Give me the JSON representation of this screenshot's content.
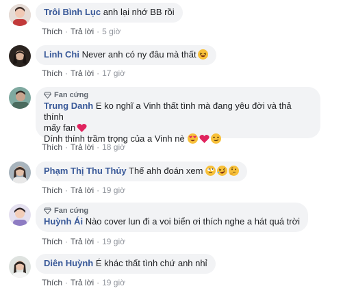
{
  "comments": [
    {
      "author": "Trôi Bình Lục",
      "text": "anh lại nhớ BB rồi",
      "like": "Thích",
      "reply": "Trả lời",
      "time": "5 giờ"
    },
    {
      "author": "Linh Chi",
      "text": "Never anh có ny đâu mà thất",
      "like": "Thích",
      "reply": "Trả lời",
      "time": "17 giờ"
    },
    {
      "badge": "Fan cứng",
      "author": "Trung Danh",
      "text_line1": "E ko nghĩ a Vinh thất tình mà đang yêu đời và thả thính",
      "text_line2": "mấy fan",
      "text_line3": "Dính thính trầm trọng của a Vinh nè",
      "like": "Thích",
      "reply": "Trả lời",
      "time": "18 giờ"
    },
    {
      "author": "Phạm Thị Thu Thủy",
      "text": "Thế ahh đoán xem",
      "like": "Thích",
      "reply": "Trả lời",
      "time": "19 giờ"
    },
    {
      "badge": "Fan cứng",
      "author": "Huỳnh Ái",
      "text": "Nào cover lun đi a voi biển ơi thích nghe a hát quá trời",
      "like": "Thích",
      "reply": "Trả lời",
      "time": "19 giờ"
    },
    {
      "author": "Diên Huỳnh",
      "text": "É khác thất tình chứ anh nhỉ",
      "like": "Thích",
      "reply": "Trả lời",
      "time": "19 giờ"
    }
  ]
}
